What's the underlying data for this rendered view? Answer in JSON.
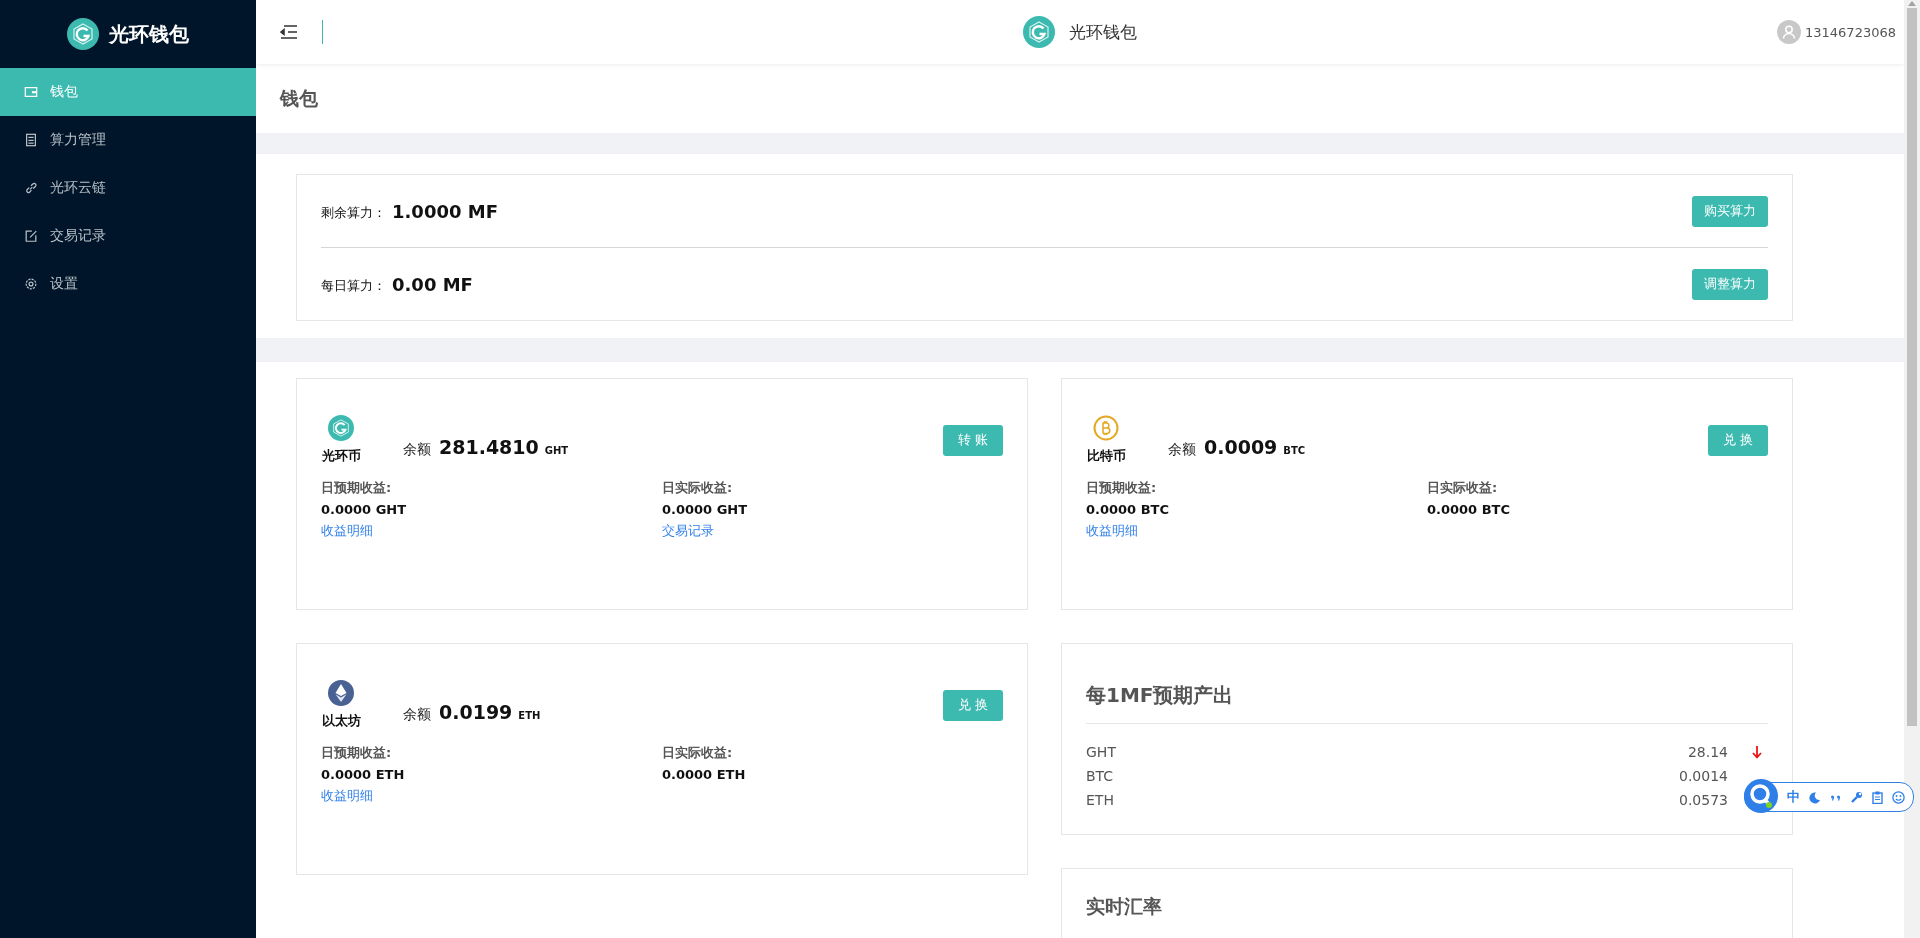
{
  "brand": {
    "name": "光环钱包"
  },
  "sidebar": {
    "items": [
      {
        "label": "钱包",
        "selected": true
      },
      {
        "label": "算力管理",
        "selected": false
      },
      {
        "label": "光环云链",
        "selected": false
      },
      {
        "label": "交易记录",
        "selected": false
      },
      {
        "label": "设置",
        "selected": false
      }
    ]
  },
  "header": {
    "title": "光环钱包",
    "user": "13146723068"
  },
  "page_title": "钱包",
  "hashrate": {
    "rows": [
      {
        "label": "剩余算力：",
        "value": "1.0000 MF",
        "button": "购买算力"
      },
      {
        "label": "每日算力：",
        "value": "0.00 MF",
        "button": "调整算力"
      }
    ]
  },
  "columns": [
    [
      {
        "kind": "coin",
        "name": "光环币",
        "balance_label": "余额",
        "balance": "281.4810",
        "unit": "GHT",
        "button": "转账",
        "expected_label": "日预期收益:",
        "expected": "0.0000 GHT",
        "expected_link": "收益明细",
        "actual_label": "日实际收益:",
        "actual": "0.0000 GHT",
        "actual_link": "交易记录"
      },
      {
        "kind": "coin",
        "name": "以太坊",
        "balance_label": "余额",
        "balance": "0.0199",
        "unit": "ETH",
        "button": "兑换",
        "expected_label": "日预期收益:",
        "expected": "0.0000 ETH",
        "expected_link": "收益明细",
        "actual_label": "日实际收益:",
        "actual": "0.0000 ETH"
      }
    ],
    [
      {
        "kind": "coin",
        "name": "比特币",
        "balance_label": "余额",
        "balance": "0.0009",
        "unit": "BTC",
        "button": "兑换",
        "expected_label": "日预期收益:",
        "expected": "0.0000 BTC",
        "expected_link": "收益明细",
        "actual_label": "日实际收益:",
        "actual": "0.0000 BTC"
      },
      {
        "kind": "yield",
        "title": "每1MF预期产出",
        "rows": [
          {
            "coin": "GHT",
            "value": "28.14",
            "falling": true
          },
          {
            "coin": "BTC",
            "value": "0.0014"
          },
          {
            "coin": "ETH",
            "value": "0.0573"
          }
        ]
      },
      {
        "kind": "rates",
        "title": "实时汇率"
      }
    ]
  ],
  "ime_toolbar": {
    "label": "中"
  }
}
